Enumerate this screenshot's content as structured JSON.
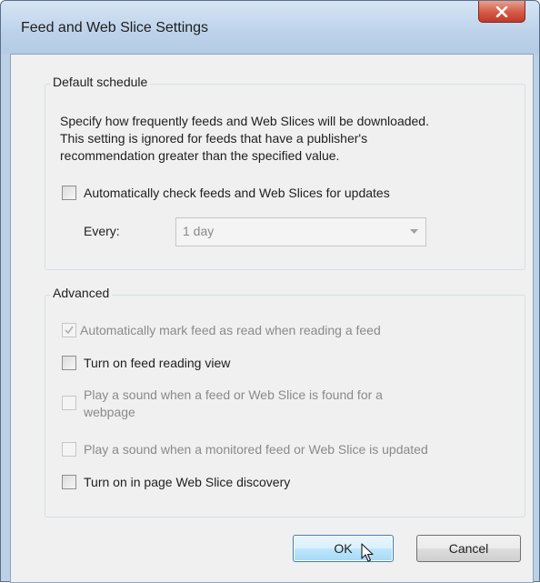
{
  "window": {
    "title": "Feed and Web Slice Settings",
    "close_icon": "close-icon"
  },
  "default_schedule": {
    "label": "Default schedule",
    "description": [
      "Specify how frequently feeds and Web Slices will be downloaded.",
      "This setting is ignored for feeds that have a publisher's",
      "recommendation greater than the specified value."
    ],
    "auto_check": {
      "label": "Automatically check feeds and Web Slices for updates",
      "checked": false,
      "enabled": true
    },
    "every_label": "Every:",
    "every_value": "1 day"
  },
  "advanced": {
    "label": "Advanced",
    "options": [
      {
        "label": "Automatically mark feed as read when reading a feed",
        "checked": true,
        "enabled": false
      },
      {
        "label": "Turn on feed reading view",
        "checked": false,
        "enabled": true
      },
      {
        "label": "Play a sound when a feed or Web Slice is found for a",
        "label2": "webpage",
        "checked": false,
        "enabled": false
      },
      {
        "label": "Play a sound when a monitored feed or Web Slice is updated",
        "checked": false,
        "enabled": false
      },
      {
        "label": "Turn on in page Web Slice discovery",
        "checked": false,
        "enabled": true
      }
    ]
  },
  "buttons": {
    "ok": "OK",
    "cancel": "Cancel"
  },
  "colors": {
    "title_bar": "#bdd2ea",
    "close_button": "#c0392b",
    "dialog_face": "#f0f0f0",
    "default_button": "#bee6fd"
  }
}
